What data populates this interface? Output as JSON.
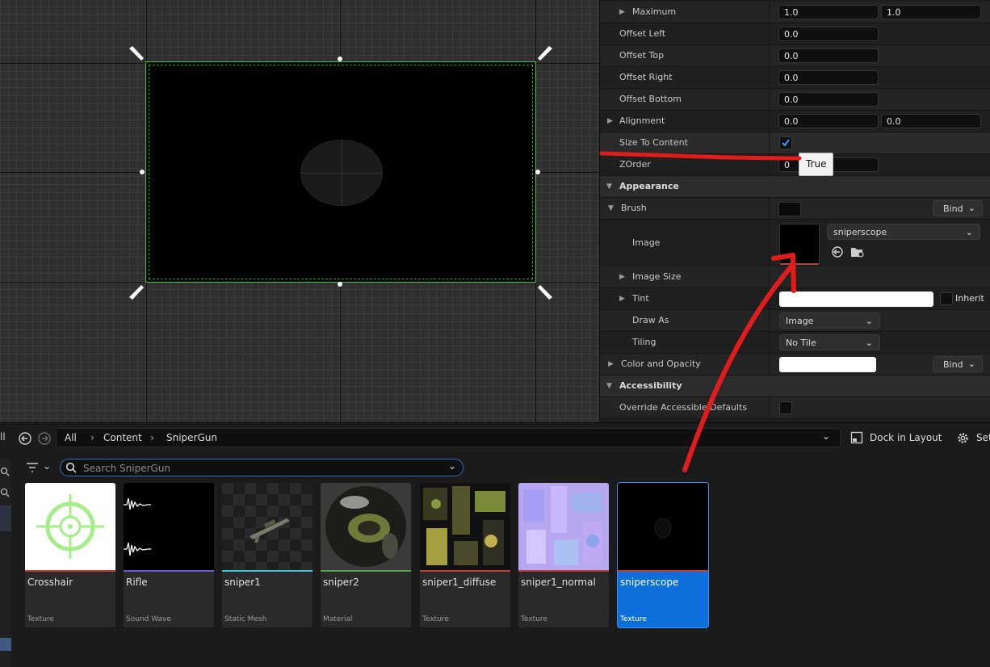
{
  "details": {
    "rows": {
      "maximum": {
        "label": "Maximum",
        "x": "1.0",
        "y": "1.0"
      },
      "offset_left": {
        "label": "Offset Left",
        "value": "0.0"
      },
      "offset_top": {
        "label": "Offset Top",
        "value": "0.0"
      },
      "offset_right": {
        "label": "Offset Right",
        "value": "0.0"
      },
      "offset_bottom": {
        "label": "Offset Bottom",
        "value": "0.0"
      },
      "alignment": {
        "label": "Alignment",
        "x": "0.0",
        "y": "0.0"
      },
      "size_to_content": {
        "label": "Size To Content",
        "checked": true
      },
      "zorder": {
        "label": "ZOrder",
        "value": "0"
      }
    },
    "tooltip": "True",
    "appearance": {
      "section_label": "Appearance",
      "brush_label": "Brush",
      "bind_label": "Bind",
      "image_label": "Image",
      "image_asset": "sniperscope",
      "image_size_label": "Image Size",
      "tint_label": "Tint",
      "inherit_label": "Inherit",
      "draw_as_label": "Draw As",
      "draw_as_value": "Image",
      "tiling_label": "Tiling",
      "tiling_value": "No Tile",
      "color_opacity_label": "Color and Opacity"
    },
    "accessibility": {
      "section_label": "Accessibility",
      "override_label": "Override Accessible Defaults"
    }
  },
  "browser": {
    "breadcrumbs": [
      "All",
      "Content",
      "SniperGun"
    ],
    "dock_label": "Dock in Layout",
    "settings_label": "Set",
    "search_placeholder": "Search SniperGun",
    "assets": [
      {
        "name": "Crosshair",
        "type": "Texture",
        "color": "#c23b3b"
      },
      {
        "name": "Rifle",
        "type": "Sound Wave",
        "color": "#6a55d6"
      },
      {
        "name": "sniper1",
        "type": "Static Mesh",
        "color": "#38c7d8"
      },
      {
        "name": "sniper2",
        "type": "Material",
        "color": "#4fa64f"
      },
      {
        "name": "sniper1_diffuse",
        "type": "Texture",
        "color": "#c23b3b"
      },
      {
        "name": "sniper1_normal",
        "type": "Texture",
        "color": "#c23b3b"
      },
      {
        "name": "sniperscope",
        "type": "Texture",
        "color": "#c23b3b"
      }
    ]
  },
  "colors": {
    "accent": "#0d6fd9",
    "selection_outline": "#34c734",
    "annotation": "#e01c1c"
  }
}
